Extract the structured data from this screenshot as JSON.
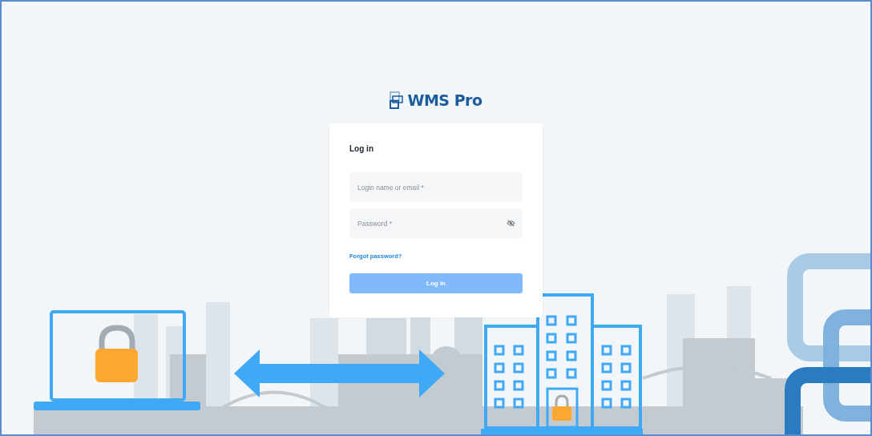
{
  "logo": {
    "text": "WMS Pro"
  },
  "login_card": {
    "title": "Log in",
    "fields": [
      {
        "kind": "text",
        "placeholder": "Login name or email *"
      },
      {
        "kind": "password",
        "placeholder": "Password *"
      }
    ],
    "forgot_link": "Forgot password?",
    "submit": {
      "label": "Log in",
      "disabled": true
    }
  }
}
